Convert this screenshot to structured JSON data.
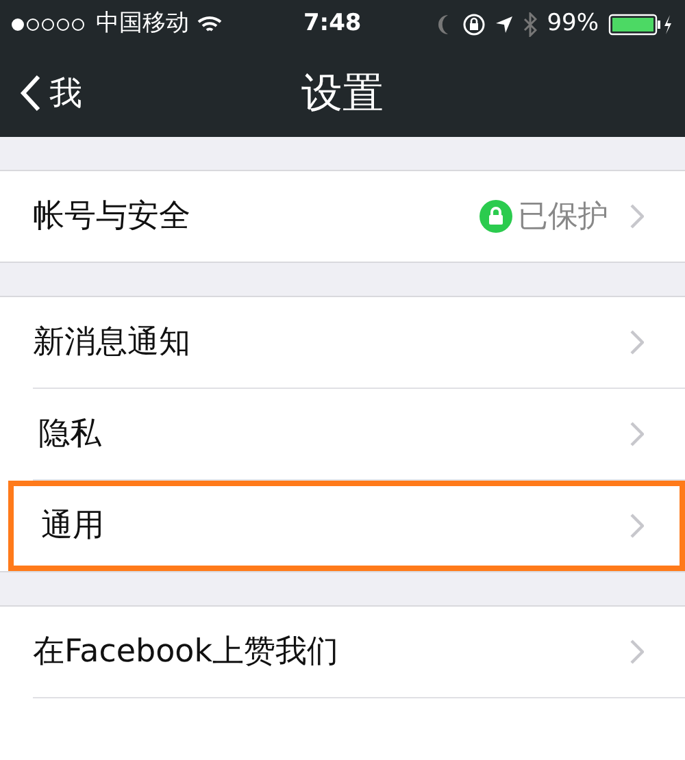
{
  "status_bar": {
    "carrier": "中国移动",
    "time": "7:48",
    "battery": "99%"
  },
  "nav_bar": {
    "back": "我",
    "title": "设置"
  },
  "groups": [
    {
      "items": [
        {
          "label": "帐号与安全",
          "value": "已保护",
          "highlighted": false
        }
      ]
    },
    {
      "items": [
        {
          "label": "新消息通知",
          "highlighted": false
        },
        {
          "label": "隐私",
          "highlighted": false
        },
        {
          "label": "通用",
          "highlighted": true
        }
      ]
    },
    {
      "items": [
        {
          "label": "在Facebook上赞我们",
          "highlighted": false
        }
      ]
    }
  ]
}
